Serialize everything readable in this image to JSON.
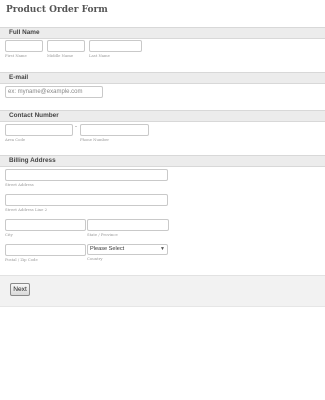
{
  "form": {
    "title": "Product Order Form"
  },
  "full_name": {
    "section_label": "Full Name",
    "first_name_value": "",
    "middle_name_value": "",
    "last_name_value": "",
    "first_name_sublabel": "First Name",
    "middle_name_sublabel": "Middle Name",
    "last_name_sublabel": "Last Name"
  },
  "email": {
    "section_label": "E-mail",
    "placeholder": "ex: myname@example.com"
  },
  "contact": {
    "section_label": "Contact Number",
    "separator": "-",
    "area_code_sublabel": "Area Code",
    "phone_sublabel": "Phone Number"
  },
  "billing": {
    "section_label": "Billing Address",
    "street_sublabel": "Street Address",
    "street2_sublabel": "Street Address Line 2",
    "city_sublabel": "City",
    "state_sublabel": "State / Province",
    "postal_sublabel": "Postal / Zip Code",
    "country_sublabel": "Country",
    "country_selected": "Please Select"
  },
  "footer": {
    "next_label": "Next"
  }
}
